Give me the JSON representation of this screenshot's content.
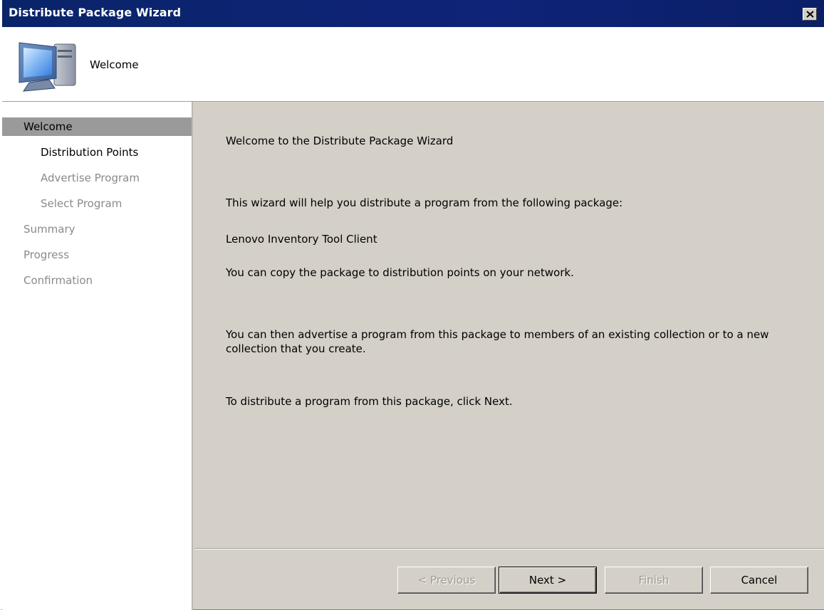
{
  "window": {
    "title": "Distribute Package Wizard",
    "close_icon": "close-icon"
  },
  "header": {
    "title": "Welcome",
    "icon": "computer-icon"
  },
  "steps": [
    {
      "label": "Welcome",
      "state": "selected",
      "indent": 0
    },
    {
      "label": "Distribution Points",
      "state": "enabled",
      "indent": 1
    },
    {
      "label": "Advertise Program",
      "state": "disabled",
      "indent": 1
    },
    {
      "label": "Select Program",
      "state": "disabled",
      "indent": 1
    },
    {
      "label": "Summary",
      "state": "disabled",
      "indent": 0
    },
    {
      "label": "Progress",
      "state": "disabled",
      "indent": 0
    },
    {
      "label": "Confirmation",
      "state": "disabled",
      "indent": 0
    }
  ],
  "content": {
    "heading": "Welcome to the Distribute Package Wizard",
    "intro": "This wizard will help you distribute a program from the following package:",
    "package_name": "Lenovo Inventory Tool Client",
    "copy_text": "You can copy the package to distribution points on your network.",
    "advertise_text": "You can then advertise a program from this package to members of an existing collection or to a new collection that you create.",
    "next_text": "To distribute a program from this package, click Next."
  },
  "buttons": {
    "previous": "< Previous",
    "next": "Next >",
    "finish": "Finish",
    "cancel": "Cancel"
  }
}
